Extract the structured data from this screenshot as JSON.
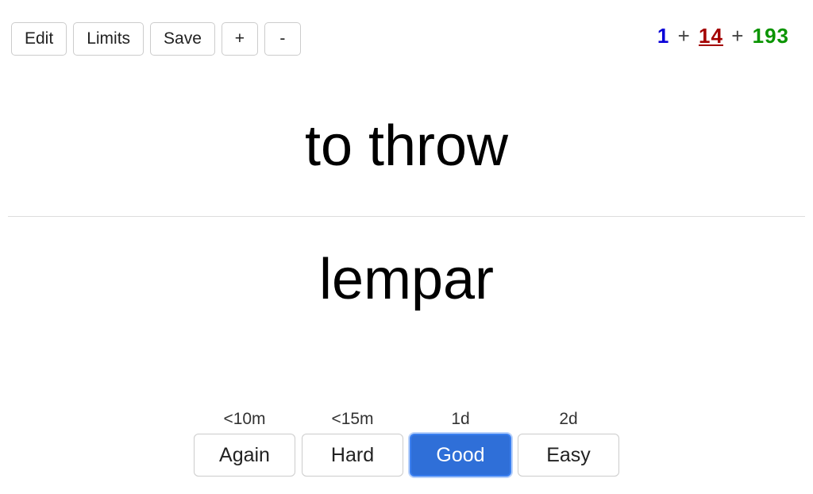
{
  "toolbar": {
    "edit": "Edit",
    "limits": "Limits",
    "save": "Save",
    "plus": "+",
    "minus": "-"
  },
  "counts": {
    "new": "1",
    "learning": "14",
    "due": "193"
  },
  "card": {
    "front": "to throw",
    "back": "lempar"
  },
  "answers": {
    "again": {
      "interval": "<10m",
      "label": "Again"
    },
    "hard": {
      "interval": "<15m",
      "label": "Hard"
    },
    "good": {
      "interval": "1d",
      "label": "Good"
    },
    "easy": {
      "interval": "2d",
      "label": "Easy"
    }
  }
}
